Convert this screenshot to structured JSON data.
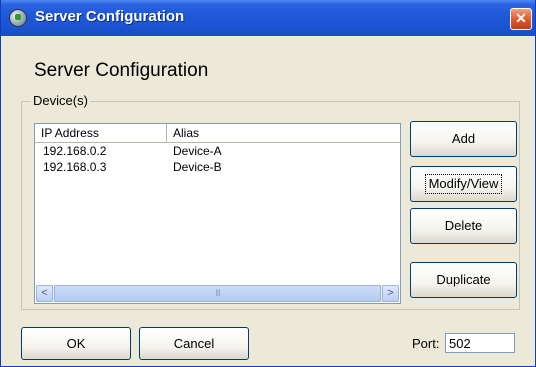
{
  "window": {
    "title": "Server Configuration",
    "close_symbol": "✕"
  },
  "heading": "Server Configuration",
  "devices_group": {
    "label": "Device(s)",
    "columns": [
      "IP Address",
      "Alias"
    ],
    "rows": [
      {
        "ip": "192.168.0.2",
        "alias": "Device-A"
      },
      {
        "ip": "192.168.0.3",
        "alias": "Device-B"
      }
    ],
    "scrollbar": {
      "left_arrow": "<",
      "right_arrow": ">",
      "thumb_grip": "III"
    }
  },
  "side_buttons": {
    "add": "Add",
    "modify_view": "Modify/View",
    "delete": "Delete",
    "duplicate": "Duplicate"
  },
  "footer": {
    "ok": "OK",
    "cancel": "Cancel",
    "port_label": "Port:",
    "port_value": "502"
  },
  "colors": {
    "titlebar": "#2a63e0",
    "dialog_bg": "#ece9d8",
    "close_button": "#e05a30",
    "button_border": "#003c74"
  },
  "icons": [
    "app-icon",
    "close-icon",
    "scroll-left-icon",
    "scroll-right-icon"
  ]
}
